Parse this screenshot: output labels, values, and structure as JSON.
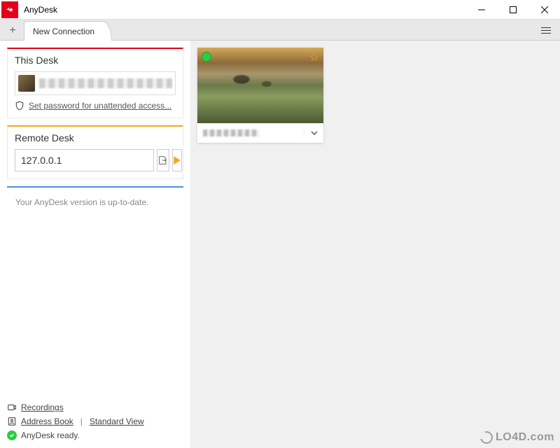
{
  "titlebar": {
    "app_name": "AnyDesk"
  },
  "tabs": {
    "new_tab_glyph": "+",
    "tab0_label": "New Connection"
  },
  "panels": {
    "this_desk": {
      "title": "This Desk",
      "password_link": "Set password for unattended access..."
    },
    "remote_desk": {
      "title": "Remote Desk",
      "input_value": "127.0.0.1"
    },
    "update": {
      "message": "Your AnyDesk version is up-to-date."
    }
  },
  "thumbnail": {
    "status": "online",
    "favorite": true
  },
  "footer": {
    "recordings": "Recordings",
    "address_book": "Address Book",
    "standard_view": "Standard View",
    "status": "AnyDesk ready."
  },
  "watermark": "LO4D.com"
}
